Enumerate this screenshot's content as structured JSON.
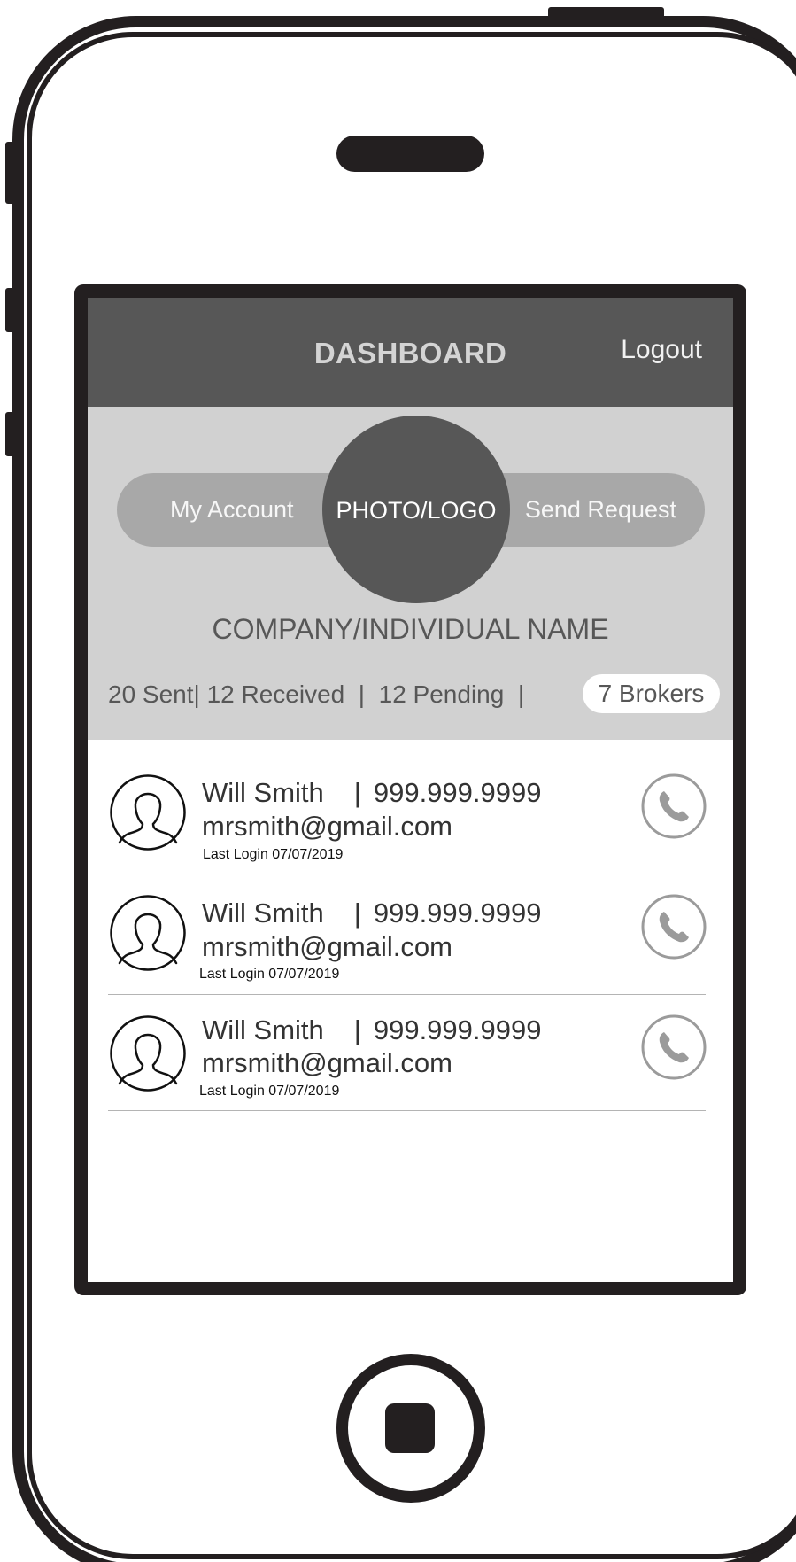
{
  "header": {
    "title": "DASHBOARD",
    "logout_label": "Logout"
  },
  "profile": {
    "my_account_label": "My Account",
    "photo_label": "PHOTO/LOGO",
    "send_request_label": "Send Request",
    "company_name": "COMPANY/INDIVIDUAL NAME",
    "stats_text": "20 Sent| 12 Received  |  12 Pending  |",
    "brokers_label": "7 Brokers"
  },
  "contacts": [
    {
      "name": "Will Smith",
      "separator": "|",
      "phone": "999.999.9999",
      "email": "mrsmith@gmail.com",
      "last_login": "Last Login 07/07/2019"
    },
    {
      "name": "Will Smith",
      "separator": "|",
      "phone": "999.999.9999",
      "email": "mrsmith@gmail.com",
      "last_login": "Last Login 07/07/2019"
    },
    {
      "name": "Will Smith",
      "separator": "|",
      "phone": "999.999.9999",
      "email": "mrsmith@gmail.com",
      "last_login": "Last Login 07/07/2019"
    }
  ],
  "icons": {
    "avatar": "user-silhouette-icon",
    "call": "phone-icon"
  },
  "colors": {
    "header_bg": "#575757",
    "profile_bg": "#d1d1d1",
    "pill_bg": "#a8a8a8",
    "frame": "#231f20"
  }
}
